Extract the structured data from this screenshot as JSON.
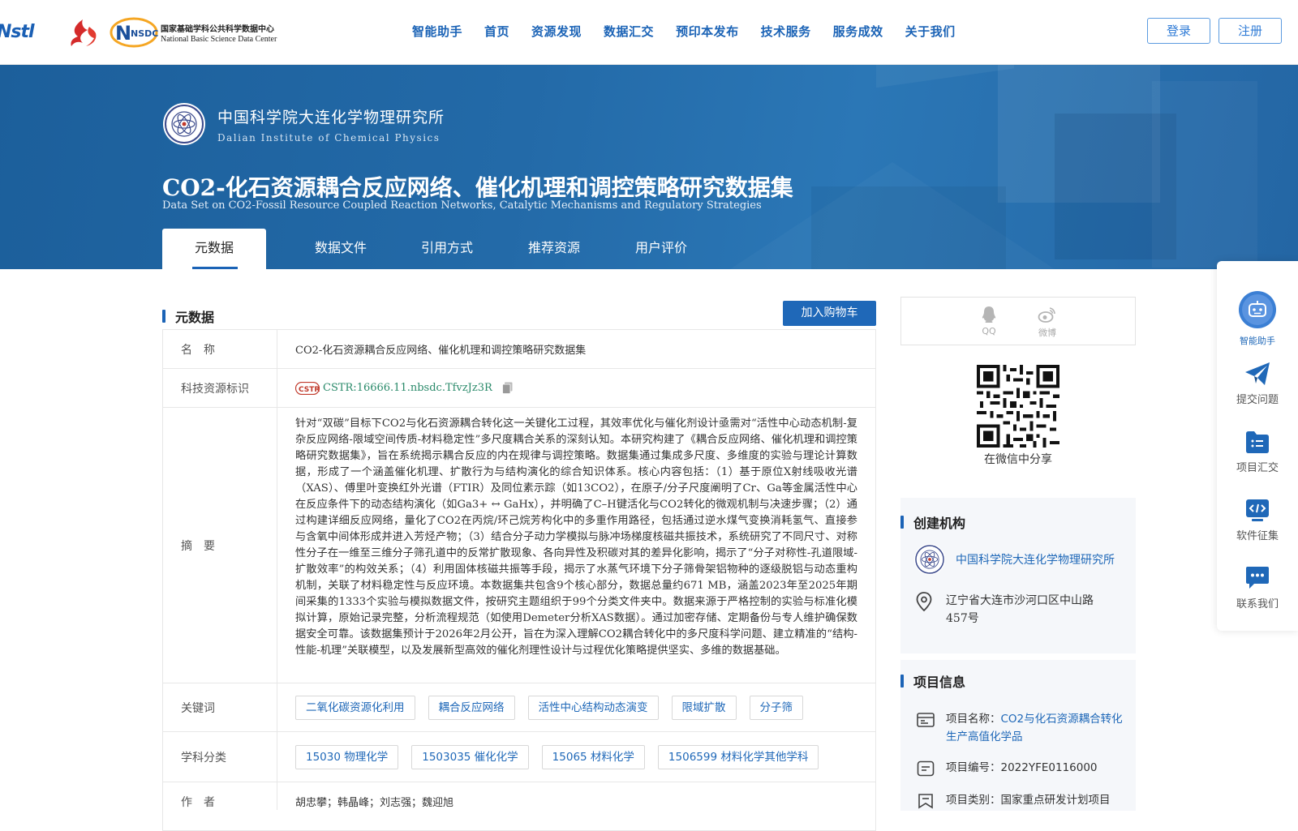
{
  "header": {
    "logo_nstl_text": "Nstl",
    "logo_nsdc_mark": "NSDC",
    "logo_nsdc_cn": "国家基础学科公共科学数据中心",
    "logo_nsdc_en": "National Basic Science Data Center",
    "nav": [
      "智能助手",
      "首页",
      "资源发现",
      "数据汇交",
      "预印本发布",
      "技术服务",
      "服务成效",
      "关于我们"
    ],
    "login_label": "登录",
    "register_label": "注册"
  },
  "banner": {
    "org_cn": "中国科学院大连化学物理研究所",
    "org_en": "Dalian Institute of Chemical Physics",
    "title": "CO2-化石资源耦合反应网络、催化机理和调控策略研究数据集",
    "title_en": "Data Set on CO2-Fossil Resource Coupled Reaction Networks, Catalytic Mechanisms and Regulatory Strategies",
    "tabs": [
      "元数据",
      "数据文件",
      "引用方式",
      "推荐资源",
      "用户评价"
    ]
  },
  "metadata": {
    "section_title": "元数据",
    "cart_label": "加入购物车",
    "name_key": "名　称",
    "name_value": "CO2-化石资源耦合反应网络、催化机理和调控策略研究数据集",
    "id_key": "科技资源标识",
    "id_badge": "CSTR",
    "id_value": "CSTR:16666.11.nbsdc.TfvzJz3R",
    "abstract_key": "摘　要",
    "abstract_value": "针对“双碳”目标下CO2与化石资源耦合转化这一关键化工过程，其效率优化与催化剂设计亟需对“活性中心动态机制-复杂反应网络-限域空间传质-材料稳定性”多尺度耦合关系的深刻认知。本研究构建了《耦合反应网络、催化机理和调控策略研究数据集》，旨在系统揭示耦合反应的内在规律与调控策略。数据集通过集成多尺度、多维度的实验与理论计算数据，形成了一个涵盖催化机理、扩散行为与结构演化的综合知识体系。核心内容包括：（1）基于原位X射线吸收光谱（XAS）、傅里叶变换红外光谱（FTIR）及同位素示踪（如13CO2），在原子/分子尺度阐明了Cr、Ga等金属活性中心在反应条件下的动态结构演化（如Ga3+ ↔ GaHx），并明确了C–H键活化与CO2转化的微观机制与决速步骤；（2）通过构建详细反应网络，量化了CO2在丙烷/环己烷芳构化中的多重作用路径，包括通过逆水煤气变换消耗氢气、直接参与含氧中间体形成并进入芳烃产物；（3）结合分子动力学模拟与脉冲场梯度核磁共振技术，系统研究了不同尺寸、对称性分子在一维至三维分子筛孔道中的反常扩散现象、各向异性及积碳对其的差异化影响，揭示了“分子对称性-孔道限域-扩散效率”的构效关系；（4）利用固体核磁共振等手段，揭示了水蒸气环境下分子筛骨架铝物种的逐级脱铝与动态重构机制，关联了材料稳定性与反应环境。本数据集共包含9个核心部分，数据总量约671 MB，涵盖2023年至2025年期间采集的1333个实验与模拟数据文件，按研究主题组织于99个分类文件夹中。数据来源于严格控制的实验与标准化模拟计算，原始记录完整，分析流程规范（如使用Demeter分析XAS数据）。通过加密存储、定期备份与专人维护确保数据安全可靠。该数据集预计于2026年2月公开，旨在为深入理解CO2耦合转化中的多尺度科学问题、建立精准的“结构-性能-机理”关联模型，以及发展新型高效的催化剂理性设计与过程优化策略提供坚实、多维的数据基础。",
    "keywords_key": "关键词",
    "keywords": [
      "二氧化碳资源化利用",
      "耦合反应网络",
      "活性中心结构动态演变",
      "限域扩散",
      "分子筛"
    ],
    "subjects_key": "学科分类",
    "subjects": [
      "15030 物理化学",
      "1503035 催化化学",
      "15065 材料化学",
      "1506599 材料化学其他学科"
    ],
    "authors_key": "作　者",
    "authors_value": "胡忠攀；韩晶峰；刘志强；魏迎旭"
  },
  "share": {
    "qq_label": "QQ",
    "weibo_label": "微博",
    "wechat_label": "在微信中分享"
  },
  "creator": {
    "section_title": "创建机构",
    "name": "中国科学院大连化学物理研究所",
    "address": "辽宁省大连市沙河口区中山路 457号"
  },
  "project": {
    "section_title": "项目信息",
    "name_label": "项目名称：",
    "name_value": "CO2与化石资源耦合转化生产高值化学品",
    "code_label": "项目编号：",
    "code_value": "2022YFE0116000",
    "type_label": "项目类别：",
    "type_value": "国家重点研发计划项目"
  },
  "float_bar": {
    "ai_label": "智能助手",
    "submit_label": "提交问题",
    "collect_label": "项目汇交",
    "software_label": "软件征集",
    "contact_label": "联系我们"
  },
  "colors": {
    "primary": "#1f68b8",
    "banner": "#236aa8",
    "cstr_green": "#2a8a6a"
  }
}
